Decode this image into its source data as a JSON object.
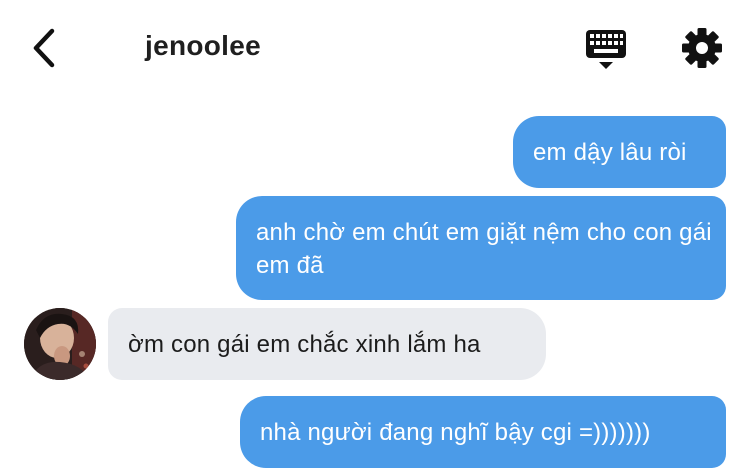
{
  "header": {
    "title": "jenoolee"
  },
  "messages": [
    {
      "direction": "out",
      "text": "em dậy lâu ròi"
    },
    {
      "direction": "out",
      "text": "anh chờ em chút em giặt nệm cho con gái em đã"
    },
    {
      "direction": "in",
      "text": "ờm con gái em chắc xinh lắm ha"
    },
    {
      "direction": "out",
      "text": "nhà người đang nghĩ bậy cgi =)))))))"
    }
  ],
  "icons": {
    "back": "chevron-left-icon",
    "keyboard": "keyboard-icon",
    "settings": "gear-icon"
  },
  "colors": {
    "outgoing_bubble": "#4b9be8",
    "incoming_bubble": "#e9ebef",
    "text_dark": "#1c1c1c"
  }
}
